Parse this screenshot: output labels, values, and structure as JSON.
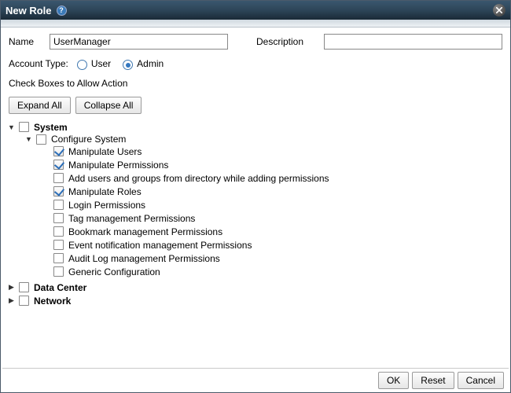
{
  "dialog": {
    "title": "New Role",
    "helpGlyph": "?"
  },
  "form": {
    "nameLabel": "Name",
    "nameValue": "UserManager",
    "descLabel": "Description",
    "descValue": "",
    "accountTypeLabel": "Account Type:",
    "userLabel": "User",
    "adminLabel": "Admin",
    "selectedAccountType": "admin"
  },
  "permissions": {
    "header": "Check Boxes to Allow Action",
    "expandAll": "Expand All",
    "collapseAll": "Collapse All",
    "tree": [
      {
        "id": "system",
        "label": "System",
        "checked": false,
        "expanded": true,
        "bold": true,
        "children": [
          {
            "id": "configure-system",
            "label": "Configure System",
            "checked": false,
            "expanded": true,
            "children": [
              {
                "id": "manipulate-users",
                "label": "Manipulate Users",
                "checked": true
              },
              {
                "id": "manipulate-permissions",
                "label": "Manipulate Permissions",
                "checked": true
              },
              {
                "id": "add-users-groups-dir",
                "label": "Add users and groups from directory while adding permissions",
                "checked": false
              },
              {
                "id": "manipulate-roles",
                "label": "Manipulate Roles",
                "checked": true
              },
              {
                "id": "login-permissions",
                "label": "Login Permissions",
                "checked": false
              },
              {
                "id": "tag-mgmt",
                "label": "Tag management Permissions",
                "checked": false
              },
              {
                "id": "bookmark-mgmt",
                "label": "Bookmark management Permissions",
                "checked": false
              },
              {
                "id": "event-notif-mgmt",
                "label": "Event notification management Permissions",
                "checked": false
              },
              {
                "id": "audit-log-mgmt",
                "label": "Audit Log management Permissions",
                "checked": false
              },
              {
                "id": "generic-config",
                "label": "Generic Configuration",
                "checked": false
              }
            ]
          }
        ]
      },
      {
        "id": "data-center",
        "label": "Data Center",
        "checked": false,
        "expanded": false,
        "bold": true,
        "children": []
      },
      {
        "id": "network",
        "label": "Network",
        "checked": false,
        "expanded": false,
        "bold": true,
        "children": []
      }
    ]
  },
  "footer": {
    "ok": "OK",
    "reset": "Reset",
    "cancel": "Cancel"
  }
}
